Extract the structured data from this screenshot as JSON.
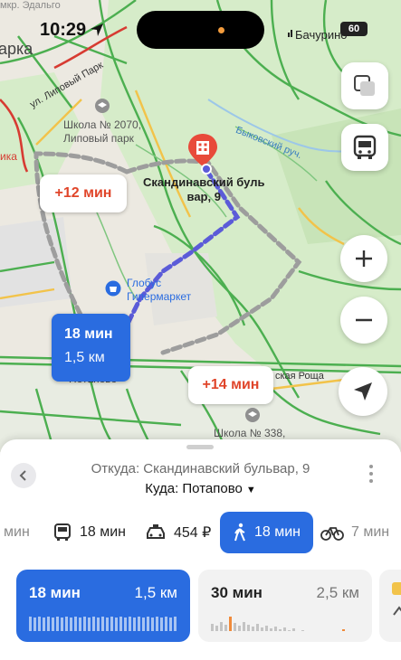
{
  "status_bar": {
    "time": "10:29",
    "carrier": "Бачурино",
    "battery": "60"
  },
  "map": {
    "labels": {
      "park": "арка",
      "street_lipovy": "ул. Липовый Парк",
      "school_2070": "Школа № 2070,\nЛиповый парк",
      "destination": "Скандинавский буль\nвар, 9",
      "street_bykovsky": "Быковский руч.",
      "globus": "Глобус\nГипермаркет",
      "potapovo": "Потапово",
      "roshcha": "ская Роща",
      "school_338": "Школа № 338,",
      "top_fragment": "мкр. Эдальго",
      "ika": "ика"
    },
    "route_main": {
      "time": "18 мин",
      "distance": "1,5 км"
    },
    "route_alt_1": "+12 мин",
    "route_alt_2": "+14 мин",
    "controls": [
      "layers-button",
      "transit-button",
      "zoom-in-button",
      "zoom-out-button",
      "my-location-button"
    ]
  },
  "sheet": {
    "from": "Откуда: Скандинавский бульвар, 9",
    "to": "Куда: Потапово",
    "modes": [
      {
        "name": "car-partial",
        "label": "мин"
      },
      {
        "name": "bus",
        "label": "18 мин"
      },
      {
        "name": "taxi",
        "label": "454 ₽"
      },
      {
        "name": "walk",
        "label": "18 мин",
        "active": true
      },
      {
        "name": "bike",
        "label": "7 мин"
      }
    ],
    "routes": [
      {
        "time": "18 мин",
        "distance": "1,5 км",
        "selected": true
      },
      {
        "time": "30 мин",
        "distance": "2,5 км",
        "selected": false
      }
    ]
  },
  "colors": {
    "accent": "#2a6ce0",
    "alt_route": "#e0452a",
    "park": "#cfe8c4",
    "road": "#3aa548"
  }
}
